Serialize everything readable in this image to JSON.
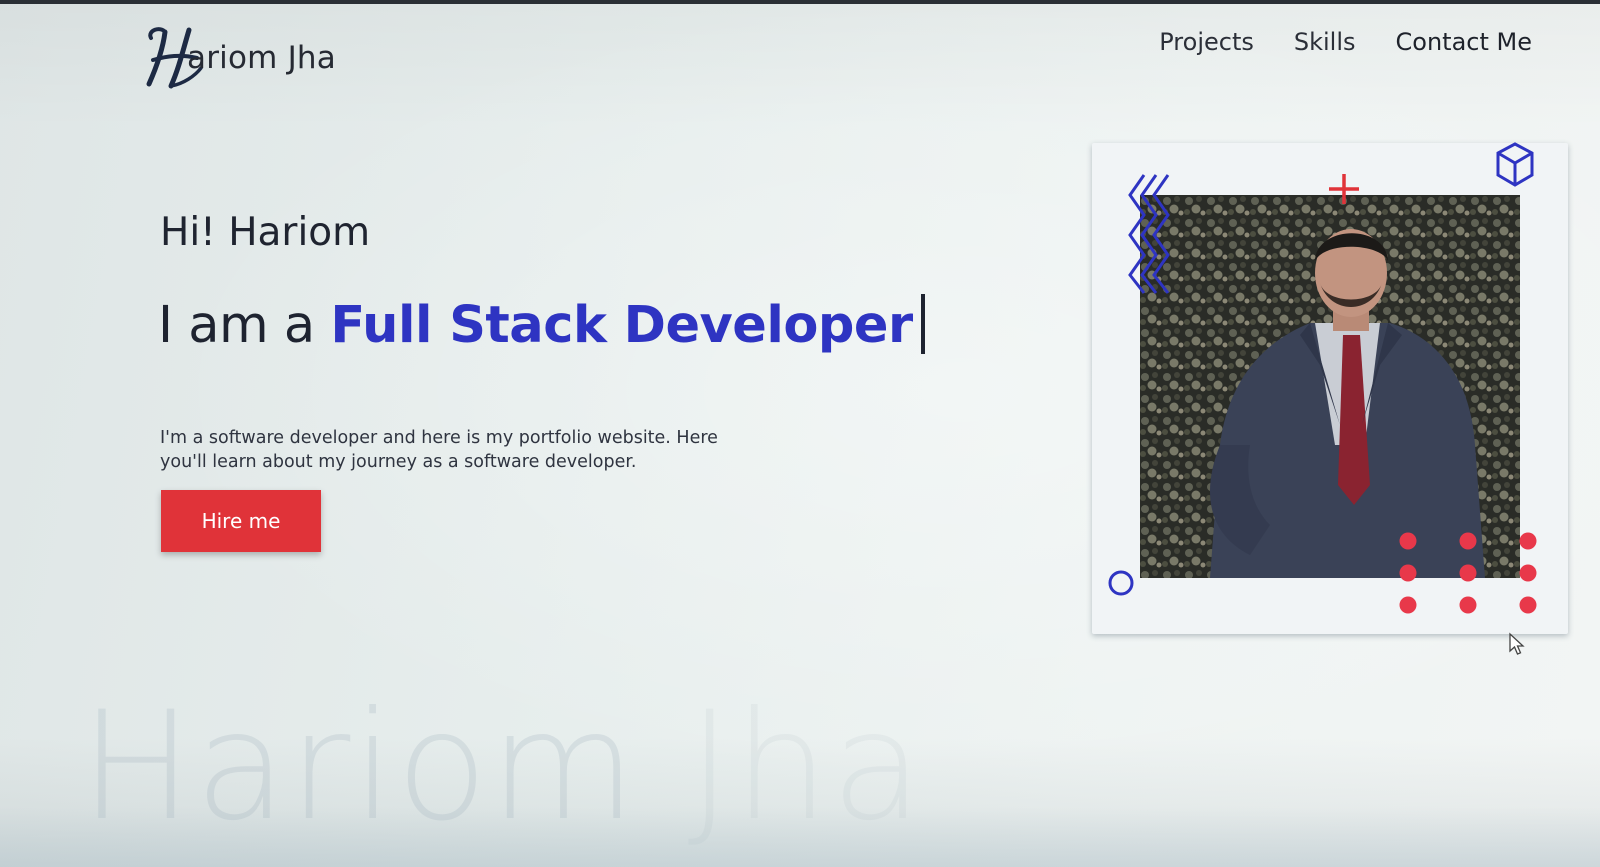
{
  "header": {
    "logo_initial": "H",
    "logo_text": "ariom Jha",
    "nav": [
      "Projects",
      "Skills",
      "Contact Me"
    ]
  },
  "hero": {
    "greeting": "Hi! Hariom",
    "headline_lead": "I am a ",
    "headline_role": "Full Stack Developer",
    "intro": "I'm a software developer and here is my portfolio website. Here you'll learn about my journey as a software developer.",
    "cta_label": "Hire me"
  },
  "watermark": {
    "main": "Hariom",
    "faded": "Jha"
  },
  "colors": {
    "accent_blue": "#2e34c2",
    "accent_red": "#e03339",
    "text_dark": "#1e2330"
  },
  "icons": [
    "cube-icon",
    "plus-icon",
    "zigzag-icon",
    "circle-icon",
    "dot-grid-icon",
    "mouse-cursor-icon"
  ]
}
